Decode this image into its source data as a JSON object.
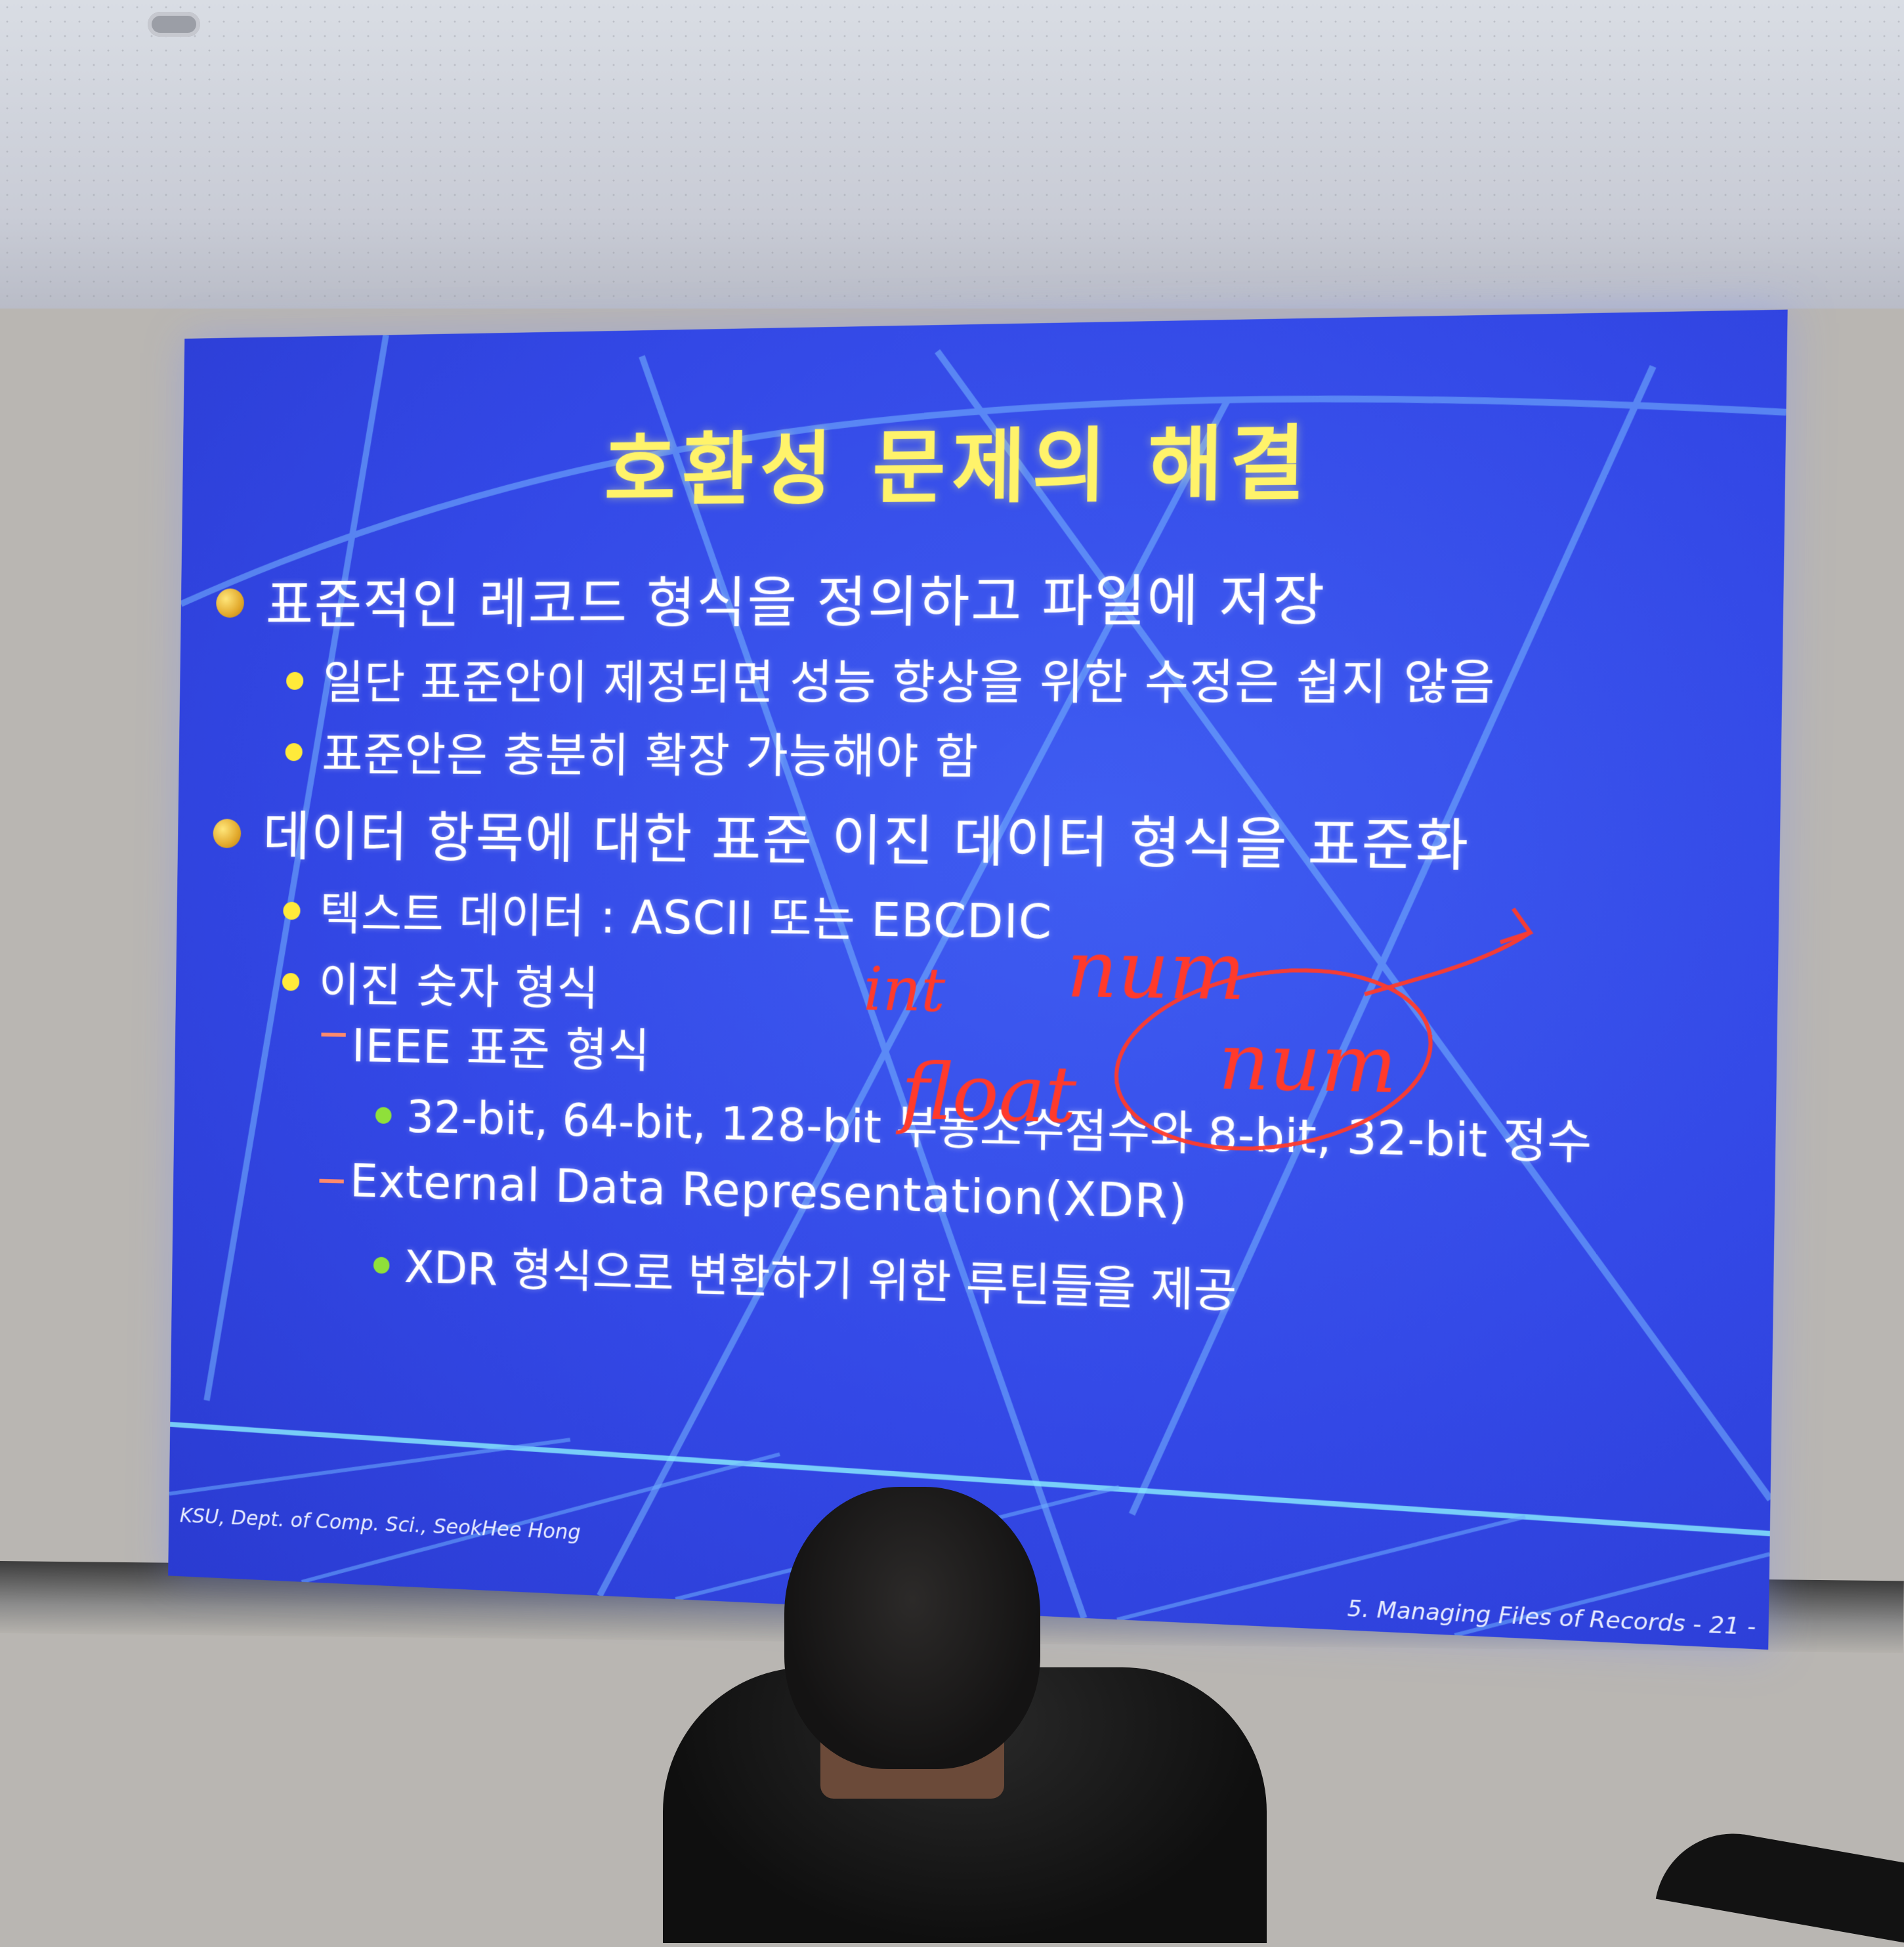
{
  "slide": {
    "title": "호환성 문제의 해결",
    "lines": [
      {
        "text": "표준적인 레코드 형식을 정의하고 파일에 저장",
        "level": 1
      },
      {
        "text": "일단 표준안이 제정되면 성능 향상을 위한 수정은 쉽지 않음",
        "level": 2
      },
      {
        "text": "표준안은 충분히 확장 가능해야 함",
        "level": 2
      },
      {
        "text": "데이터 항목에 대한 표준 이진 데이터 형식을 표준화",
        "level": 1
      },
      {
        "text": "텍스트 데이터 : ASCII 또는 EBCDIC",
        "level": 2
      },
      {
        "text": "이진 숫자 형식",
        "level": 2
      },
      {
        "text": "IEEE 표준 형식",
        "level": 3
      },
      {
        "text": "32-bit, 64-bit, 128-bit 부동소수점수와 8-bit, 32-bit 정수",
        "level": 4
      },
      {
        "text": "External Data Representation(XDR)",
        "level": 3
      },
      {
        "text": "XDR 형식으로 변환하기 위한 루틴들을 제공",
        "level": 4
      }
    ],
    "footer_left": "KSU, Dept. of Comp. Sci., SeokHee Hong",
    "footer_right": "5. Managing Files of Records  - 21 -"
  },
  "annotations": {
    "int": "int",
    "num1": "num",
    "float": "float",
    "num2": "num",
    "color": "#ff3a2b"
  },
  "colors": {
    "slide_bg": "#3348e6",
    "title": "#fff36a",
    "text": "#ffffff",
    "bullet_level1": "#e2a92c",
    "bullet_level2": "#ffea3a",
    "bullet_level4": "#8fe03a",
    "dash_level3": "#ff8a6b"
  }
}
